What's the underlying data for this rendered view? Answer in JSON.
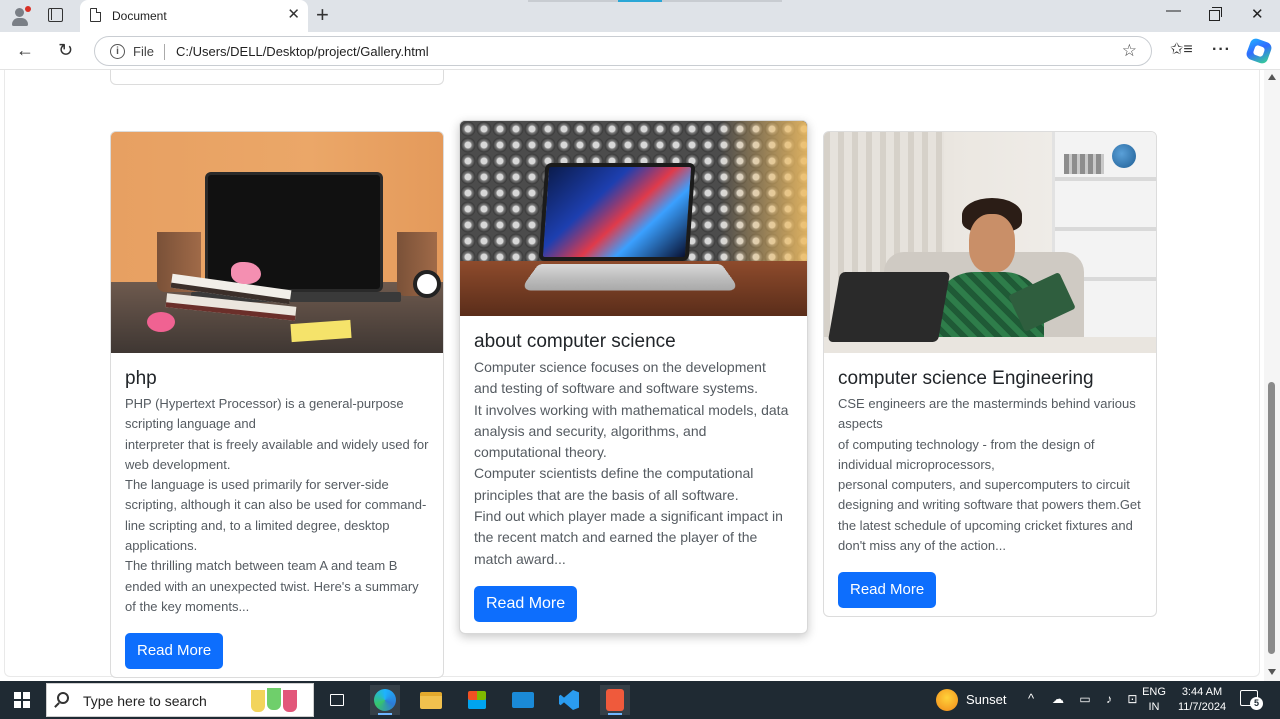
{
  "browser": {
    "tab_title": "Document",
    "tab_close": "✕",
    "new_tab": "+",
    "address_scheme": "File",
    "address_url": "C:/Users/DELL/Desktop/project/Gallery.html",
    "back": "←",
    "refresh": "↻",
    "favorite": "☆",
    "more": "···",
    "favorites_bar": "✩≡",
    "min": "—",
    "close": "✕"
  },
  "cards": [
    {
      "title": "php",
      "paragraphs": [
        "PHP (Hypertext Processor) is a general-purpose scripting language and",
        "interpreter that is freely available and widely used for web development.",
        "The language is used primarily for server-side scripting, although it can also be used for command-line scripting and, to a limited degree, desktop applications.",
        "The thrilling match between team A and team B ended with an unexpected twist. Here's a summary of the key moments..."
      ],
      "button": "Read More"
    },
    {
      "title": "about computer science",
      "paragraphs": [
        "Computer science focuses on the development and testing of software and software systems.",
        "It involves working with mathematical models, data analysis and security, algorithms, and computational theory.",
        "Computer scientists define the computational principles that are the basis of all software.",
        "Find out which player made a significant impact in the recent match and earned the player of the match award..."
      ],
      "button": "Read More"
    },
    {
      "title": "computer science Engineering",
      "paragraphs": [
        "CSE engineers are the masterminds behind various aspects",
        "of computing technology - from the design of individual microprocessors,",
        "personal computers, and supercomputers to circuit designing and writing software that powers them.Get the latest schedule of upcoming cricket fixtures and don't miss any of the action..."
      ],
      "button": "Read More"
    }
  ],
  "taskbar": {
    "search_placeholder": "Type here to search",
    "weather": "Sunset",
    "tray_chevron": "^",
    "tray_icons": "☁ ▭ ♪ ⊡",
    "lang_line1": "ENG",
    "lang_line2": "IN",
    "time": "3:44 AM",
    "date": "11/7/2024",
    "notification_count": "5"
  },
  "colors": {
    "primary_button": "#0d6efd",
    "taskbar": "#1f2a33",
    "titlebar": "#dfe3e8"
  }
}
